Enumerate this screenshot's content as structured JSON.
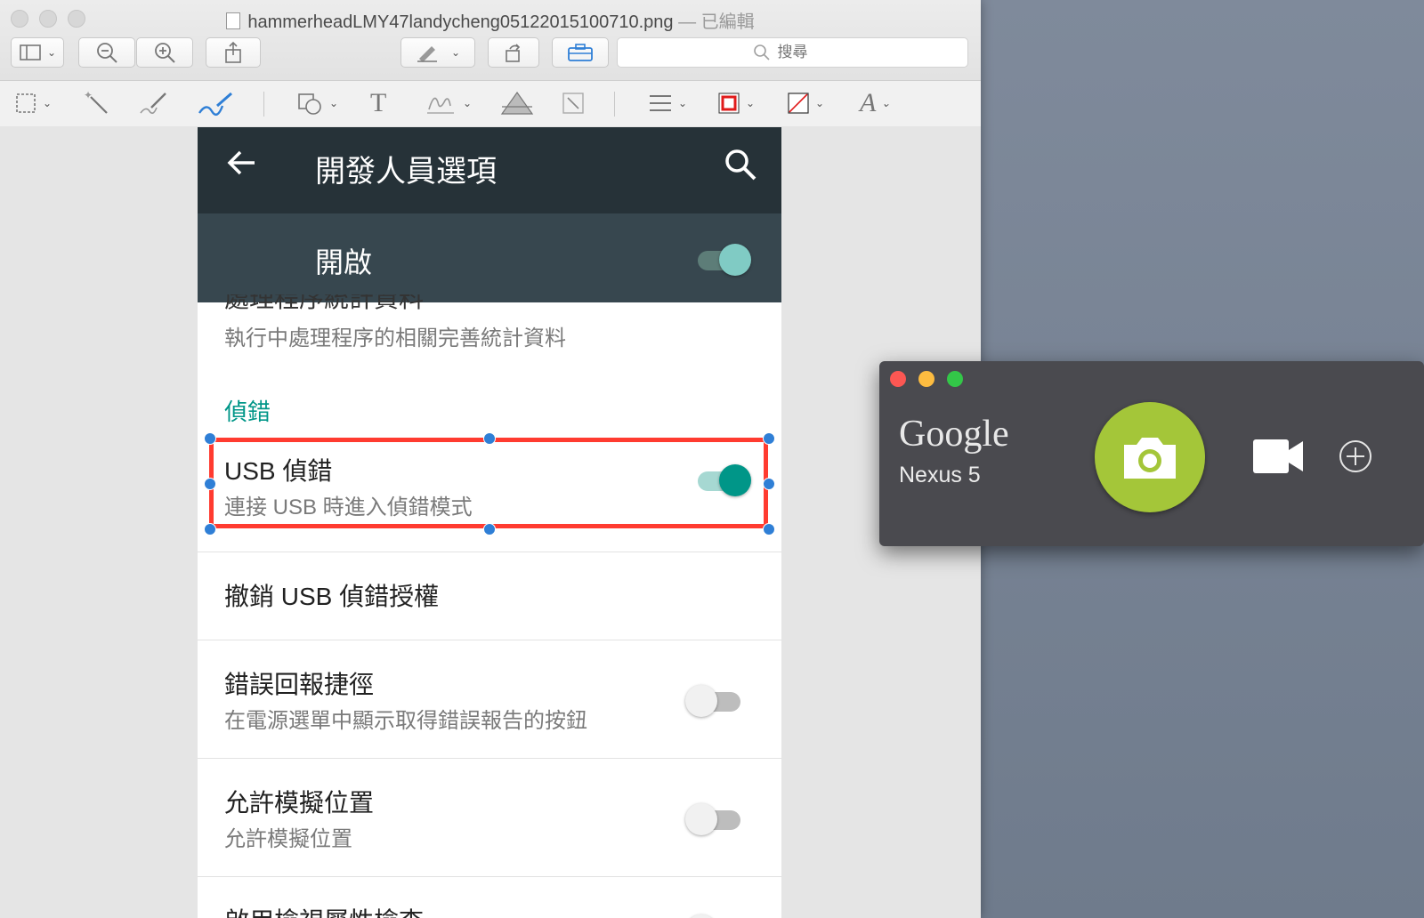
{
  "preview": {
    "filename": "hammerheadLMY47landycheng05122015100710.png",
    "edited_label": "— 已編輯",
    "search_placeholder": "搜尋"
  },
  "android": {
    "appbar_title": "開發人員選項",
    "master_switch_label": "開啟",
    "master_switch_on": true,
    "cut_off_title": "處理程序統計資料",
    "cut_off_subtitle": "執行中處理程序的相關完善統計資料",
    "section_header": "偵錯",
    "rows": [
      {
        "title": "USB 偵錯",
        "subtitle": "連接 USB 時進入偵錯模式",
        "toggle": "on"
      },
      {
        "title": "撤銷 USB 偵錯授權",
        "subtitle": "",
        "toggle": "none"
      },
      {
        "title": "錯誤回報捷徑",
        "subtitle": "在電源選單中顯示取得錯誤報告的按鈕",
        "toggle": "off"
      },
      {
        "title": "允許模擬位置",
        "subtitle": "允許模擬位置",
        "toggle": "off"
      },
      {
        "title": "啟用檢視屬性檢查",
        "subtitle": "",
        "toggle": "off"
      }
    ]
  },
  "capture_app": {
    "brand": "Google",
    "device": "Nexus 5"
  },
  "colors": {
    "appbar": "#263238",
    "switchbar": "#37474f",
    "accent": "#009688",
    "annotation": "#ff3b30",
    "shutter": "#a4c639"
  },
  "icons": [
    "sidebar-icon",
    "zoom-out-icon",
    "zoom-in-icon",
    "share-icon",
    "pen-icon",
    "rotate-icon",
    "toolbox-icon",
    "search-icon",
    "selection-icon",
    "magic-wand-icon",
    "sketch-icon",
    "draw-icon",
    "shapes-icon",
    "text-icon",
    "signature-icon",
    "adjust-color-icon",
    "resize-icon",
    "line-style-icon",
    "border-color-icon",
    "fill-color-icon",
    "font-icon",
    "back-arrow-icon",
    "camera-icon",
    "video-camera-icon",
    "plus-circle-icon"
  ]
}
